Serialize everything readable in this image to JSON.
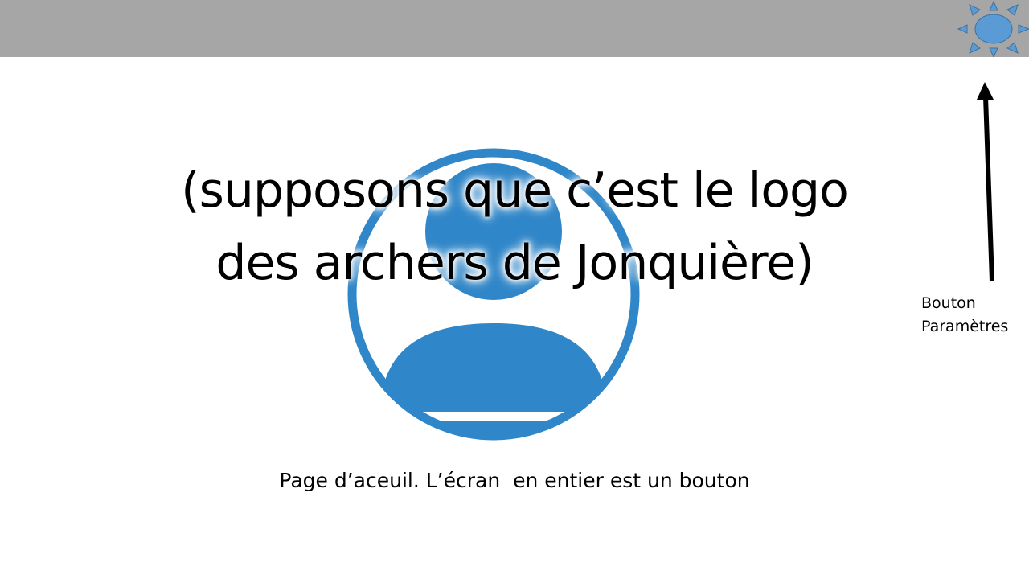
{
  "top_bar": {
    "color": "#a6a6a6",
    "settings_icon": "sun-icon",
    "settings_icon_color": "#5b9bd5"
  },
  "logo": {
    "icon": "user-avatar-icon",
    "color": "#2f86c8"
  },
  "title": {
    "line1": "(supposons que c’est le logo",
    "line2": "des archers de Jonquière)"
  },
  "annotation": {
    "arrow_icon": "arrow-up-icon",
    "label_line1": "Bouton",
    "label_line2": "Paramètres"
  },
  "caption": "Page d’aceuil. L’écran  en entier est un bouton"
}
